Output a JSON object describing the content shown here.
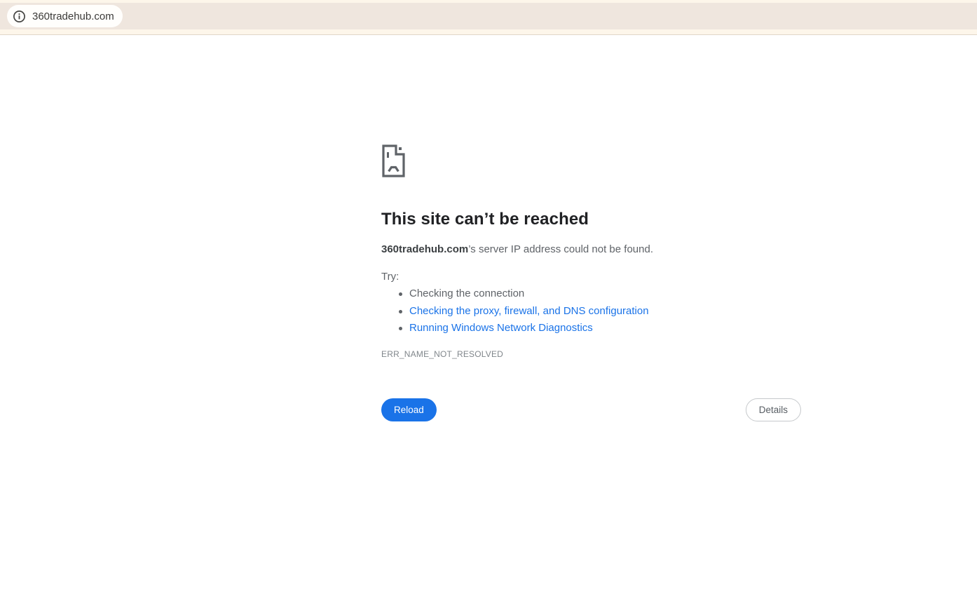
{
  "browser": {
    "url": "360tradehub.com"
  },
  "error_page": {
    "title": "This site can’t be reached",
    "subtitle_domain": "360tradehub.com",
    "subtitle_rest": "’s server IP address could not be found.",
    "try_label": "Try:",
    "suggestions": [
      {
        "label": "Checking the connection",
        "link": false
      },
      {
        "label": "Checking the proxy, firewall, and DNS configuration",
        "link": true
      },
      {
        "label": "Running Windows Network Diagnostics",
        "link": true
      }
    ],
    "error_code": "ERR_NAME_NOT_RESOLVED",
    "reload_label": "Reload",
    "details_label": "Details"
  },
  "colors": {
    "toolbar_cream": "#fdf6ea",
    "toolbar_band": "#efe6de",
    "omnibox_bg": "#fffefc",
    "link_blue": "#1a73e8",
    "primary_button_blue": "#1a73e8",
    "title_dark": "#202124",
    "body_gray": "#5f6368",
    "error_code_gray": "#80868b"
  }
}
